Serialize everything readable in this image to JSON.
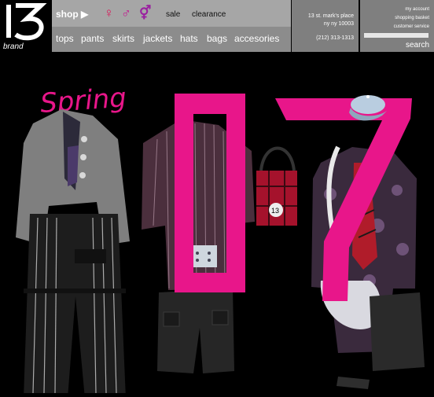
{
  "brand": {
    "logo_text": "13 brand"
  },
  "nav": {
    "shop_label": "shop ▶",
    "gender_symbols": [
      {
        "glyph": "♀",
        "color": "#d81a5a"
      },
      {
        "glyph": "♂",
        "color": "#c2188f"
      },
      {
        "glyph": "⚥",
        "color": "#9a1fa0"
      }
    ],
    "sale": "sale",
    "clearance": "clearance",
    "categories": [
      "tops",
      "pants",
      "skirts",
      "jackets",
      "hats",
      "bags",
      "accesories"
    ]
  },
  "store": {
    "address_line1": "13 st. mark's place",
    "address_line2": "ny ny 10003",
    "phone": "(212) 313-1313"
  },
  "account": {
    "my_account": "my account",
    "shopping_basket": "shopping basket",
    "customer_service": "customer service",
    "search_placeholder": "",
    "search_label": "search"
  },
  "hero": {
    "headline": "Spring",
    "big_text": "07",
    "accent_color": "#e8168a"
  }
}
